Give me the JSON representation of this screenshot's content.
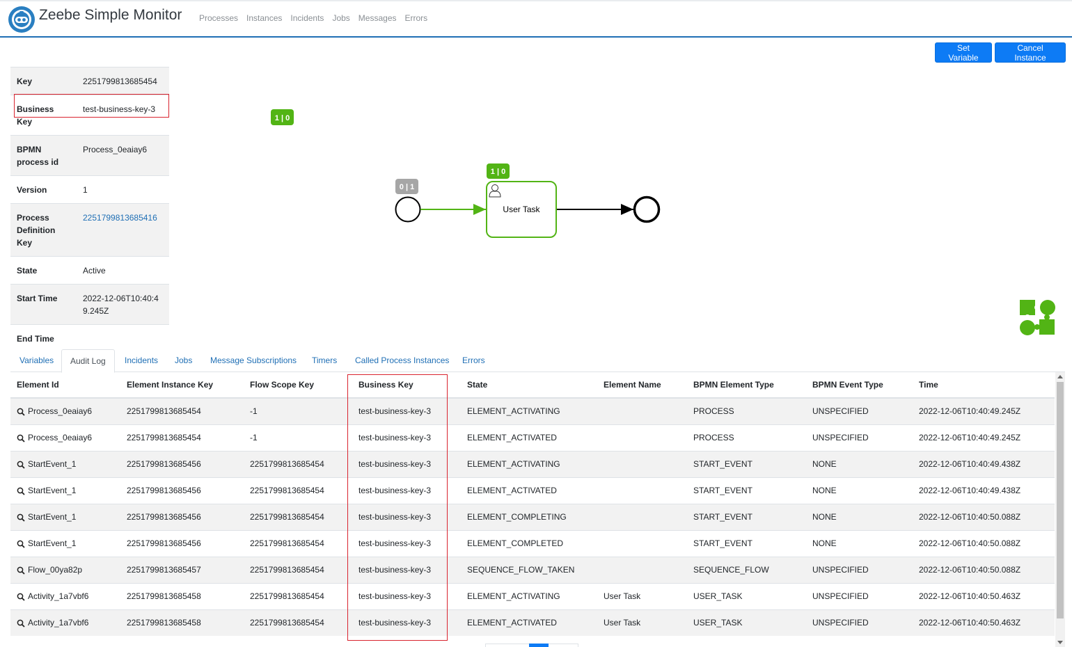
{
  "app": {
    "title": "Zeebe Simple Monitor"
  },
  "nav": {
    "items": [
      "Processes",
      "Instances",
      "Incidents",
      "Jobs",
      "Messages",
      "Errors"
    ]
  },
  "actions": {
    "set_variable": "Set Variable",
    "cancel_instance": "Cancel Instance"
  },
  "info": {
    "rows": [
      {
        "key": "Key",
        "value": "2251799813685454"
      },
      {
        "key": "Business Key",
        "value": "test-business-key-3"
      },
      {
        "key": "BPMN process id",
        "value": "Process_0eaiay6"
      },
      {
        "key": "Version",
        "value": "1"
      },
      {
        "key": "Process Definition Key",
        "value": "2251799813685416"
      },
      {
        "key": "State",
        "value": "Active"
      },
      {
        "key": "Start Time",
        "value": "2022-12-06T10:40:49.245Z"
      },
      {
        "key": "End Time",
        "value": ""
      }
    ]
  },
  "diagram": {
    "process_badge": "1 | 0",
    "start_badge": "0 | 1",
    "task_badge": "1 | 0",
    "task_label": "User Task",
    "colors": {
      "active": "#52b415",
      "badge_gray": "#a6a6a6"
    }
  },
  "tabs": [
    "Variables",
    "Audit Log",
    "Incidents",
    "Jobs",
    "Message Subscriptions",
    "Timers",
    "Called Process Instances",
    "Errors"
  ],
  "audit": {
    "columns": [
      "Element Id",
      "Element Instance Key",
      "Flow Scope Key",
      "Business Key",
      "State",
      "Element Name",
      "BPMN Element Type",
      "BPMN Event Type",
      "Time"
    ],
    "rows": [
      [
        "Process_0eaiay6",
        "2251799813685454",
        "-1",
        "test-business-key-3",
        "ELEMENT_ACTIVATING",
        "",
        "PROCESS",
        "UNSPECIFIED",
        "2022-12-06T10:40:49.245Z"
      ],
      [
        "Process_0eaiay6",
        "2251799813685454",
        "-1",
        "test-business-key-3",
        "ELEMENT_ACTIVATED",
        "",
        "PROCESS",
        "UNSPECIFIED",
        "2022-12-06T10:40:49.245Z"
      ],
      [
        "StartEvent_1",
        "2251799813685456",
        "2251799813685454",
        "test-business-key-3",
        "ELEMENT_ACTIVATING",
        "",
        "START_EVENT",
        "NONE",
        "2022-12-06T10:40:49.438Z"
      ],
      [
        "StartEvent_1",
        "2251799813685456",
        "2251799813685454",
        "test-business-key-3",
        "ELEMENT_ACTIVATED",
        "",
        "START_EVENT",
        "NONE",
        "2022-12-06T10:40:49.438Z"
      ],
      [
        "StartEvent_1",
        "2251799813685456",
        "2251799813685454",
        "test-business-key-3",
        "ELEMENT_COMPLETING",
        "",
        "START_EVENT",
        "NONE",
        "2022-12-06T10:40:50.088Z"
      ],
      [
        "StartEvent_1",
        "2251799813685456",
        "2251799813685454",
        "test-business-key-3",
        "ELEMENT_COMPLETED",
        "",
        "START_EVENT",
        "NONE",
        "2022-12-06T10:40:50.088Z"
      ],
      [
        "Flow_00ya82p",
        "2251799813685457",
        "2251799813685454",
        "test-business-key-3",
        "SEQUENCE_FLOW_TAKEN",
        "",
        "SEQUENCE_FLOW",
        "UNSPECIFIED",
        "2022-12-06T10:40:50.088Z"
      ],
      [
        "Activity_1a7vbf6",
        "2251799813685458",
        "2251799813685454",
        "test-business-key-3",
        "ELEMENT_ACTIVATING",
        "User Task",
        "USER_TASK",
        "UNSPECIFIED",
        "2022-12-06T10:40:50.463Z"
      ],
      [
        "Activity_1a7vbf6",
        "2251799813685458",
        "2251799813685454",
        "test-business-key-3",
        "ELEMENT_ACTIVATED",
        "User Task",
        "USER_TASK",
        "UNSPECIFIED",
        "2022-12-06T10:40:50.463Z"
      ]
    ]
  },
  "icons": {
    "logo": "zeebe-logo-icon",
    "search": "magnifier-icon",
    "user": "user-task-icon",
    "minimap": "puzzle-icon"
  },
  "colors": {
    "primary": "#0d7bf5",
    "link": "#1f6fb5",
    "highlight": "#d9232e"
  }
}
